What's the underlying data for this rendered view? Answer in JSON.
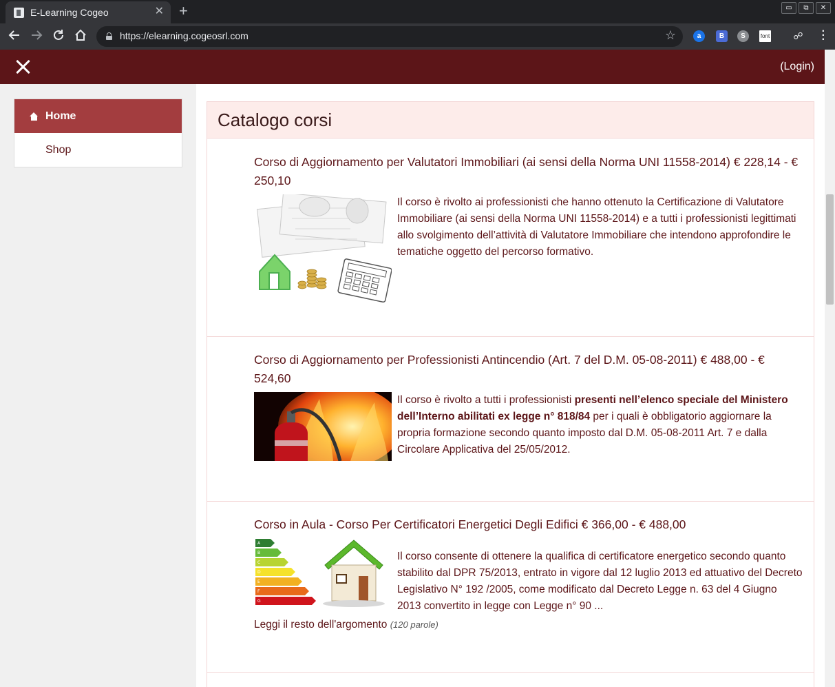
{
  "browser": {
    "tab_title": "E-Learning Cogeo",
    "tab_close": "✕",
    "new_tab": "+",
    "url": "https://elearning.cogeosrl.com",
    "win_minimize": "▭",
    "win_restore": "⧉",
    "win_close": "✕"
  },
  "header": {
    "login_label": "(Login)"
  },
  "sidebar": {
    "items": [
      {
        "label": "Home"
      },
      {
        "label": "Shop"
      }
    ]
  },
  "catalog": {
    "title": "Catalogo corsi",
    "courses": [
      {
        "title": "Corso di Aggiornamento per Valutatori Immobiliari (ai sensi della Norma UNI 11558-2014) € 228,14 - € 250,10",
        "desc": "Il corso è rivolto ai professionisti che hanno ottenuto la Certificazione di Valutatore Immobiliare (ai sensi della Norma UNI 11558-2014) e a tutti i professionisti legittimati allo svolgimento dell’attività di Valutatore Immobiliare che intendono approfondire le tematiche oggetto del percorso formativo."
      },
      {
        "title": "Corso di Aggiornamento per Professionisti Antincendio (Art. 7 del D.M. 05-08-2011) € 488,00 - € 524,60",
        "desc_before": "Il corso è rivolto a tutti i professionisti ",
        "desc_bold": "presenti nell’elenco speciale del Ministero dell’Interno abilitati ex legge n° 818/84",
        "desc_after": " per i quali è obbligatorio aggiornare la propria formazione secondo quanto imposto dal D.M. 05-08-2011 Art. 7 e dalla Circolare Applicativa del 25/05/2012."
      },
      {
        "title": "Corso in Aula - Corso Per Certificatori Energetici Degli Edifici € 366,00 - € 488,00",
        "desc": "Il corso consente di ottenere la qualifica di certificatore energetico secondo quanto stabilito dal DPR 75/2013, entrato in vigore dal 12 luglio 2013 ed attuativo del Decreto Legislativo N° 192 /2005, come modificato dal Decreto Legge n. 63 del 4 Giugno 2013 convertito in legge con Legge n° 90 ...",
        "read_more": "Leggi il resto dell'argomento",
        "word_count": "(120 parole)",
        "energy_classes": [
          "A",
          "B",
          "C",
          "D",
          "E",
          "F",
          "G"
        ]
      }
    ]
  },
  "colors": {
    "brand_dark": "#5c1518",
    "brand_active": "#a33d3f",
    "catalog_header_bg": "#fdecea"
  }
}
